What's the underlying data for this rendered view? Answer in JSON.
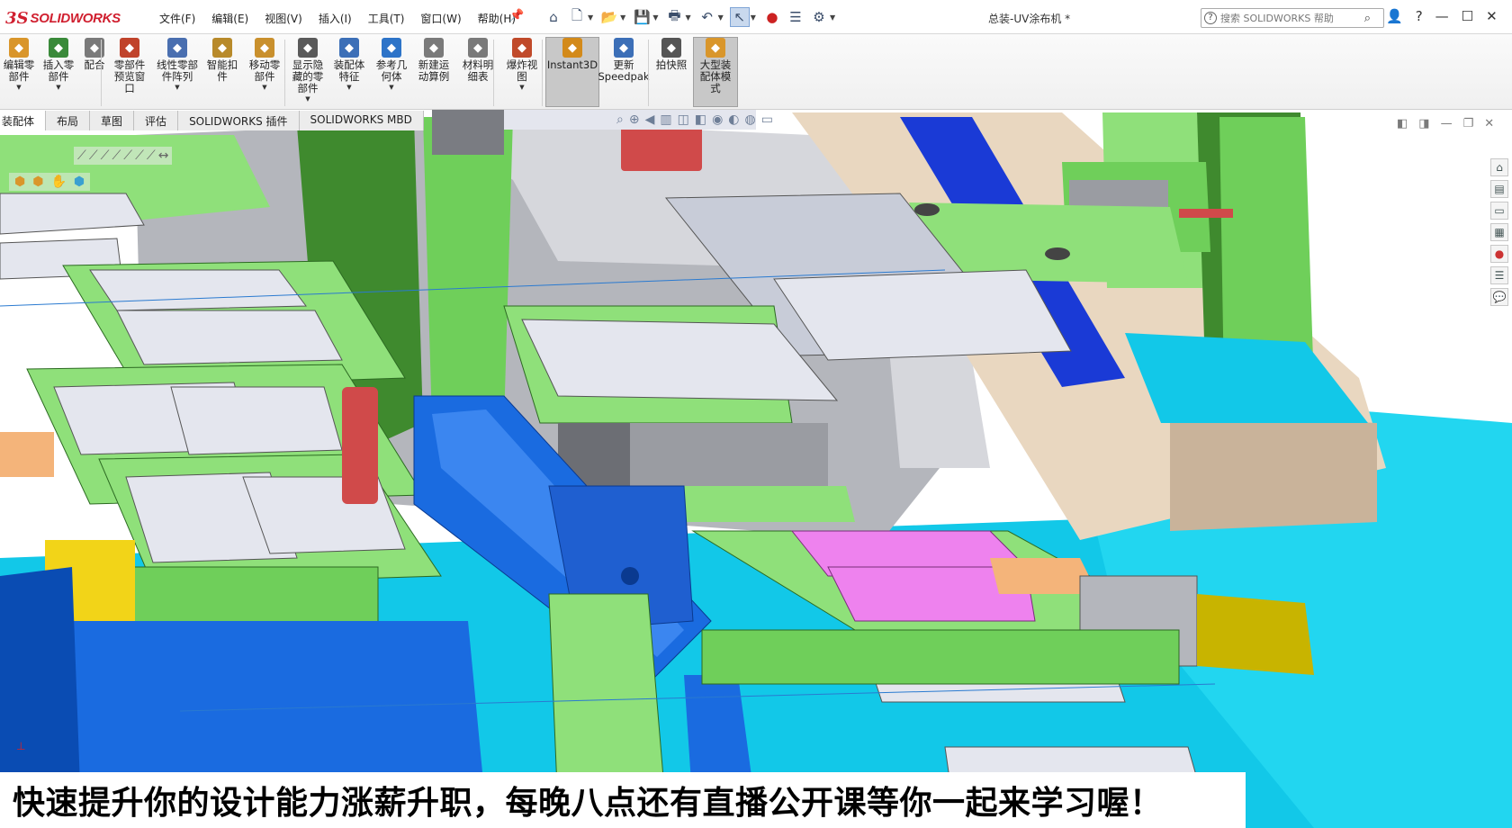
{
  "app": {
    "title": "总装-UV涂布机 *",
    "logo": {
      "ds": "3S",
      "name": "SOLIDWORKS"
    }
  },
  "menu": [
    "文件(F)",
    "编辑(E)",
    "视图(V)",
    "插入(I)",
    "工具(T)",
    "窗口(W)",
    "帮助(H)"
  ],
  "search": {
    "placeholder": "搜索 SOLIDWORKS 帮助"
  },
  "ribbon": {
    "buttons": [
      {
        "label": "编辑零\n部件",
        "icon": "edit-component-icon",
        "color": "#d9962b"
      },
      {
        "label": "插入零\n部件",
        "icon": "insert-component-icon",
        "color": "#3a8a3a"
      },
      {
        "label": "配合",
        "icon": "mate-icon",
        "color": "#7a7a7a"
      },
      {
        "label": "零部件\n预览窗\n口",
        "icon": "component-preview-icon",
        "color": "#c0432b"
      },
      {
        "label": "线性零部\n件阵列",
        "icon": "linear-pattern-icon",
        "color": "#4a6fb0"
      },
      {
        "label": "智能扣\n件",
        "icon": "smart-fastener-icon",
        "color": "#b88a2a"
      },
      {
        "label": "移动零\n部件",
        "icon": "move-component-icon",
        "color": "#c9902d"
      },
      {
        "label": "显示隐\n藏的零\n部件",
        "icon": "show-hidden-icon",
        "color": "#5a5a5a"
      },
      {
        "label": "装配体\n特征",
        "icon": "assembly-feature-icon",
        "color": "#3c6fb7"
      },
      {
        "label": "参考几\n何体",
        "icon": "reference-geometry-icon",
        "color": "#2d74c8"
      },
      {
        "label": "新建运\n动算例",
        "icon": "motion-study-icon",
        "color": "#7a7a7a"
      },
      {
        "label": "材料明\n细表",
        "icon": "bom-icon",
        "color": "#7a7a7a"
      },
      {
        "label": "爆炸视\n图",
        "icon": "exploded-view-icon",
        "color": "#c04a2a"
      },
      {
        "label": "Instant3D",
        "icon": "instant3d-icon",
        "color": "#d38a1a"
      },
      {
        "label": "更新\nSpeedpak",
        "icon": "speedpak-icon",
        "color": "#3c6fb7"
      },
      {
        "label": "拍快照",
        "icon": "snapshot-icon",
        "color": "#555555"
      },
      {
        "label": "大型装\n配体模\n式",
        "icon": "large-assembly-icon",
        "color": "#d9962b"
      }
    ]
  },
  "command_tabs": [
    "装配体",
    "布局",
    "草图",
    "评估",
    "SOLIDWORKS 插件",
    "SOLIDWORKS MBD"
  ],
  "subtitle": "快速提升你的设计能力涨薪升职，每晚八点还有直播公开课等你一起来学习喔！",
  "colors": {
    "green_plate": "#8fe07a",
    "green_dark": "#3f8a2e",
    "blue_base": "#1a6be0",
    "cyan_base": "#12c8e8",
    "magenta": "#ee82ee",
    "silver": "#c8ccd8",
    "tan": "#e9d7c0"
  }
}
